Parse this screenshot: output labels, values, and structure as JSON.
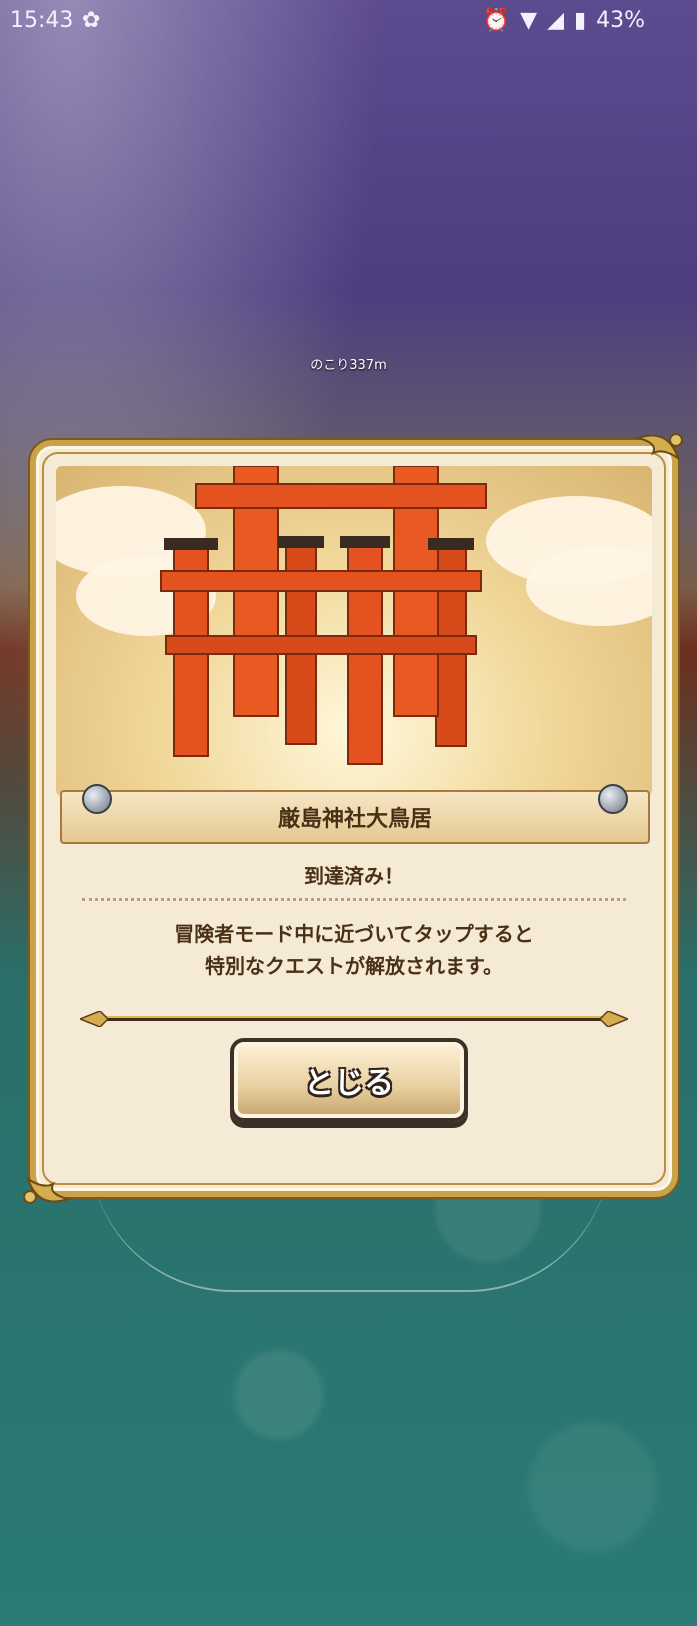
{
  "status_bar": {
    "time": "15:43",
    "battery": "43%",
    "icons": [
      "blossom-icon",
      "alarm-icon",
      "wifi-icon",
      "signal-icon",
      "battery-icon"
    ]
  },
  "map": {
    "remaining_distance": "のこり337m"
  },
  "dialog": {
    "title": "厳島神社大鳥居",
    "reached_label": "到達済み！",
    "description_line1": "冒険者モード中に近づいてタップすると",
    "description_line2": "特別なクエストが解放されます。",
    "close_button": "とじる"
  },
  "colors": {
    "frame_gold": "#caa24b",
    "card_bg": "#f5ead5",
    "torii_red": "#e3521f",
    "text_brown": "#4a3017"
  }
}
